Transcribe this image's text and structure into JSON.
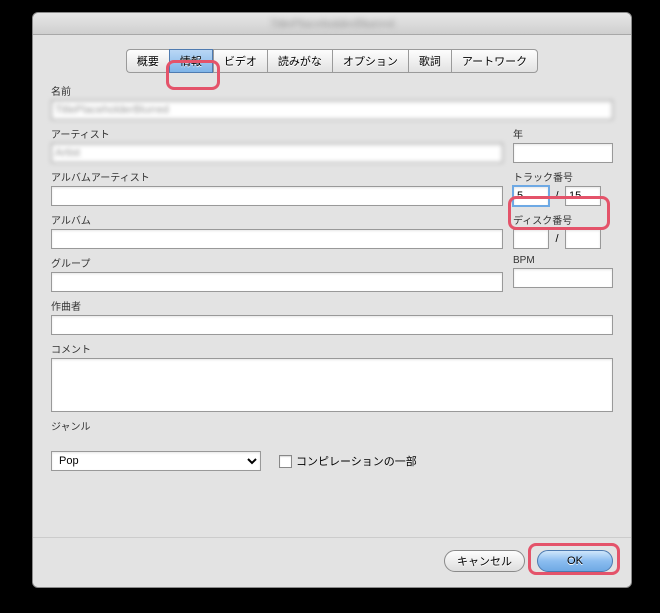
{
  "window": {
    "title": "TitlePlaceholderBlurred"
  },
  "tabs": {
    "items": [
      "概要",
      "情報",
      "ビデオ",
      "読みがな",
      "オプション",
      "歌詞",
      "アートワーク"
    ],
    "active_index": 1
  },
  "labels": {
    "name": "名前",
    "artist": "アーティスト",
    "year": "年",
    "album_artist": "アルバムアーティスト",
    "track_no": "トラック番号",
    "album": "アルバム",
    "disc_no": "ディスク番号",
    "grouping": "グループ",
    "bpm": "BPM",
    "composer": "作曲者",
    "comments": "コメント",
    "genre": "ジャンル",
    "compilation": "コンピレーションの一部"
  },
  "fields": {
    "name": "TitlePlaceholderBlurred",
    "artist": "Artist",
    "year": "",
    "album_artist": "",
    "track_curr": "5",
    "track_total": "15",
    "album": "",
    "disc_curr": "",
    "disc_total": "",
    "grouping": "",
    "bpm": "",
    "composer": "",
    "comments": "",
    "genre": "Pop",
    "compilation_checked": false,
    "slash": "/"
  },
  "buttons": {
    "cancel": "キャンセル",
    "ok": "OK"
  }
}
